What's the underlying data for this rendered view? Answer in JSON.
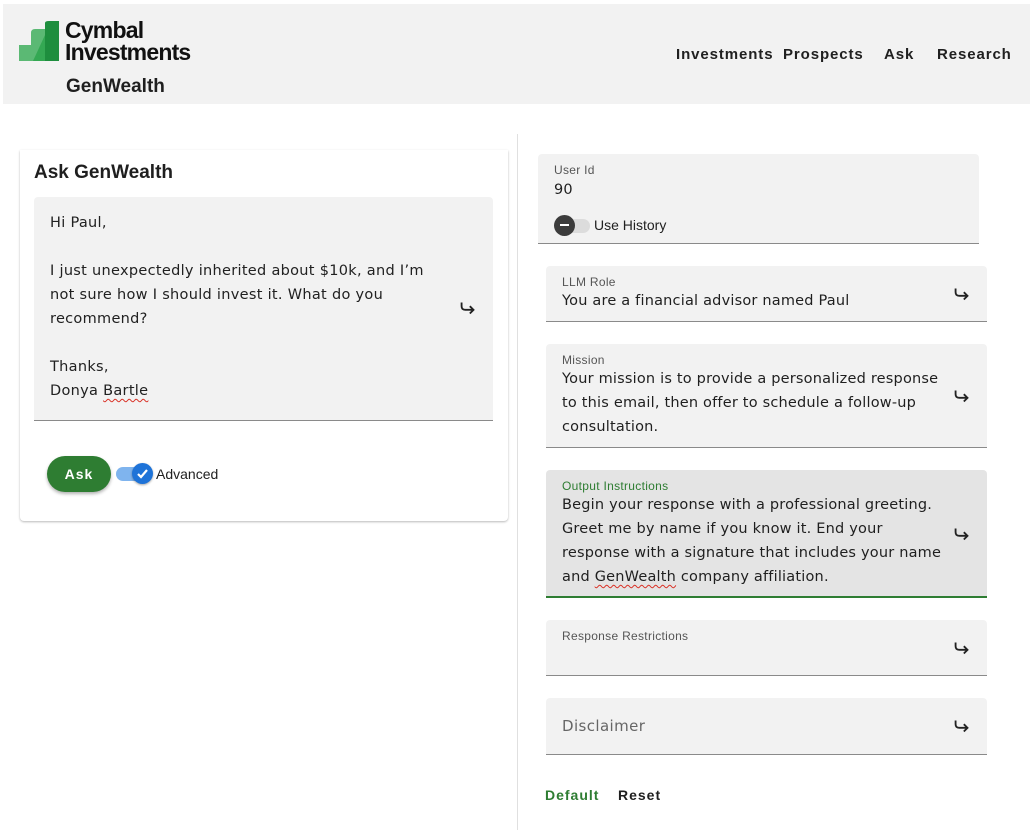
{
  "brand": {
    "logo_text_line1": "Cymbal",
    "logo_text_line2": "Investments",
    "product": "GenWealth",
    "colors": {
      "logo_dark": "#1e8e3e",
      "logo_light": "#5bb974",
      "accent": "#2e7d32",
      "toggle_blue": "#1e73d8"
    }
  },
  "nav": {
    "items": [
      {
        "label": "Investments"
      },
      {
        "label": "Prospects"
      },
      {
        "label": "Ask"
      },
      {
        "label": "Research"
      }
    ]
  },
  "ask_card": {
    "title": "Ask GenWealth",
    "email": {
      "greeting": "Hi Paul,",
      "body": "I just unexpectedly inherited about $10k, and I’m not sure how I should invest it. What do you recommend?",
      "closing": "Thanks,",
      "signer_first": "Donya",
      "signer_last": "Bartle",
      "send_icon": "send-arrow-icon"
    },
    "ask_button": "Ask",
    "advanced_toggle": {
      "label": "Advanced",
      "checked": true
    }
  },
  "settings": {
    "user_id": {
      "label": "User Id",
      "value": "90"
    },
    "use_history": {
      "label": "Use History",
      "checked": false
    },
    "llm_role": {
      "label": "LLM Role",
      "value": "You are a financial advisor named Paul"
    },
    "mission": {
      "label": "Mission",
      "value": "Your mission is to provide a personalized response to this email, then offer to schedule a follow-up consultation."
    },
    "output_instructions": {
      "label": "Output Instructions",
      "value_before": "Begin your response with a professional greeting. Greet me by name if you know it. End your response with a signature that includes your name and ",
      "value_misspelled": "GenWealth",
      "value_after": " company affiliation."
    },
    "response_restrictions": {
      "label": "Response Restrictions",
      "value": ""
    },
    "disclaimer": {
      "placeholder": "Disclaimer",
      "value": ""
    },
    "default_button": "Default",
    "reset_button": "Reset"
  }
}
